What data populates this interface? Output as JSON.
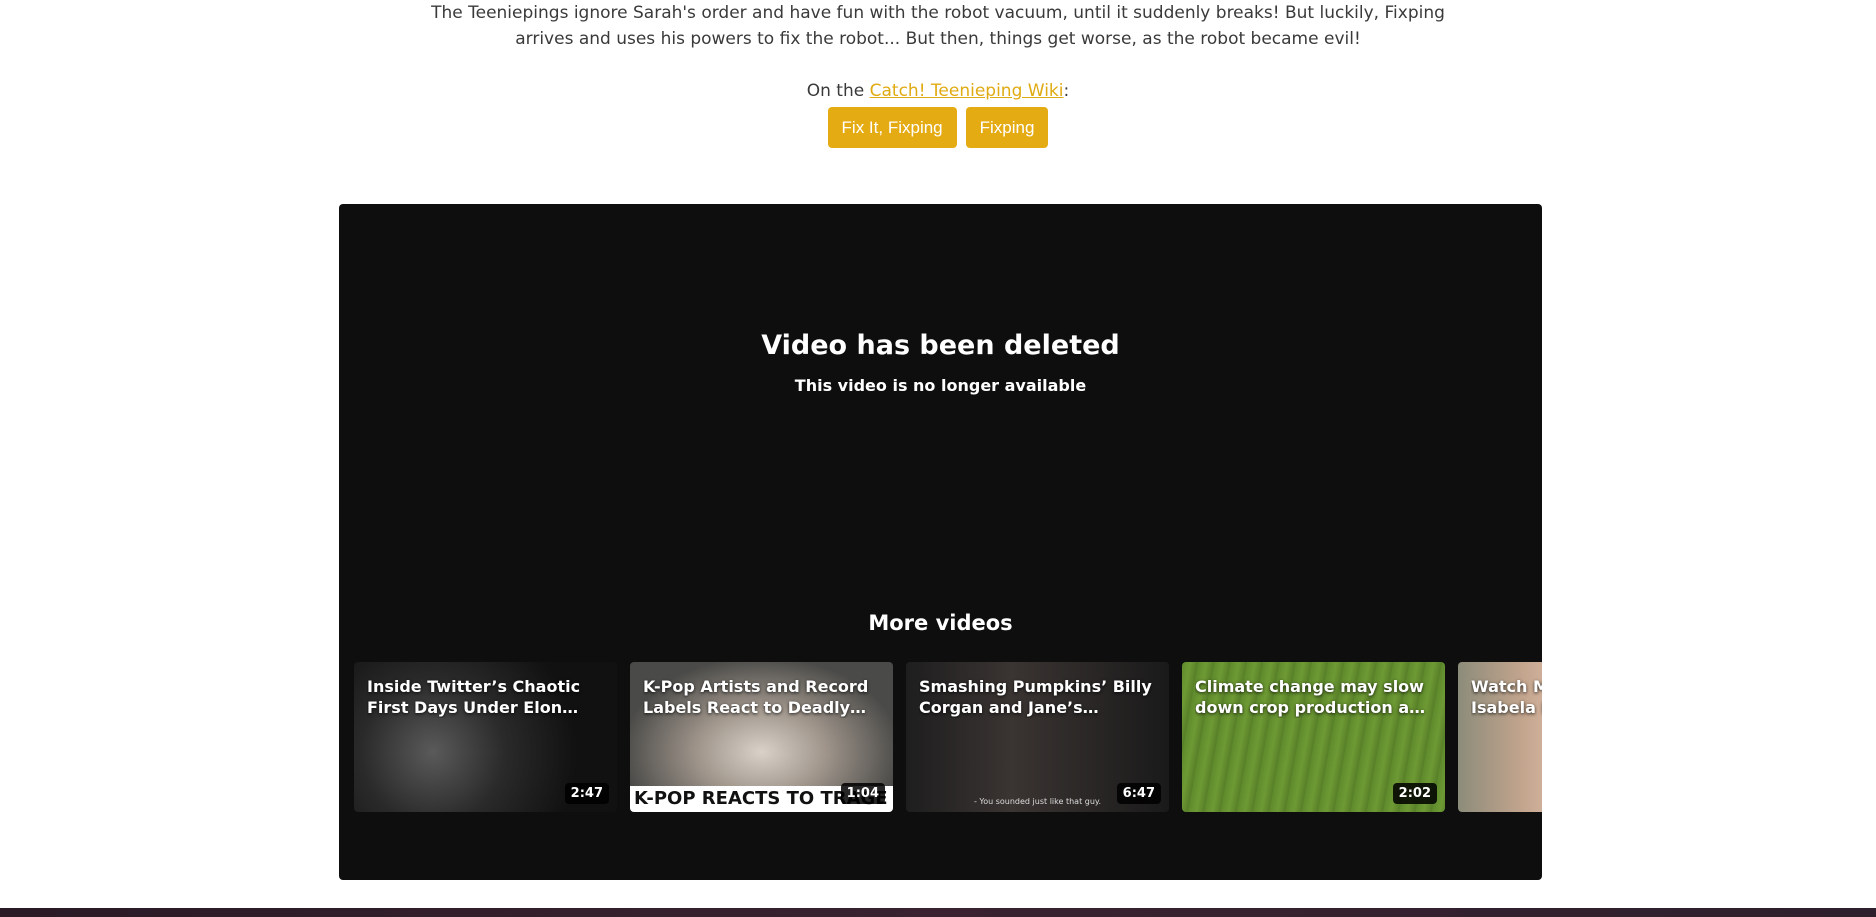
{
  "description": {
    "line1": "The Teeniepings ignore Sarah's order and have fun with the robot vacuum, until it suddenly breaks! But luckily, Fixping",
    "line2": "arrives and uses his powers to fix the robot... But then, things get worse, as the robot became evil!"
  },
  "wiki": {
    "prefix": "On the ",
    "link": "Catch! Teenieping Wiki",
    "suffix": ":"
  },
  "tags": [
    "Fix It, Fixping",
    "Fixping"
  ],
  "player": {
    "deleted_title": "Video has been deleted",
    "deleted_subtitle": "This video is no longer available",
    "more_videos": "More videos",
    "videos": [
      {
        "title": "Inside Twitter’s Chaotic First Days Under Elon Musk",
        "duration": "2:47"
      },
      {
        "title": "K-Pop Artists and Record Labels React to Deadly…",
        "duration": "1:04",
        "banner": "K-POP REACTS TO TRAGE"
      },
      {
        "title": "Smashing Pumpkins’ Billy Corgan and Jane’s Addiction’…",
        "duration": "6:47",
        "caption": "- You sounded just like that guy."
      },
      {
        "title": "Climate change may slow down crop production as earl…",
        "duration": "2:02"
      },
      {
        "title": "Watch M Isabela M",
        "duration": ""
      }
    ]
  },
  "colors": {
    "accent": "#e5ab12",
    "player_bg": "#0e0e0e"
  }
}
